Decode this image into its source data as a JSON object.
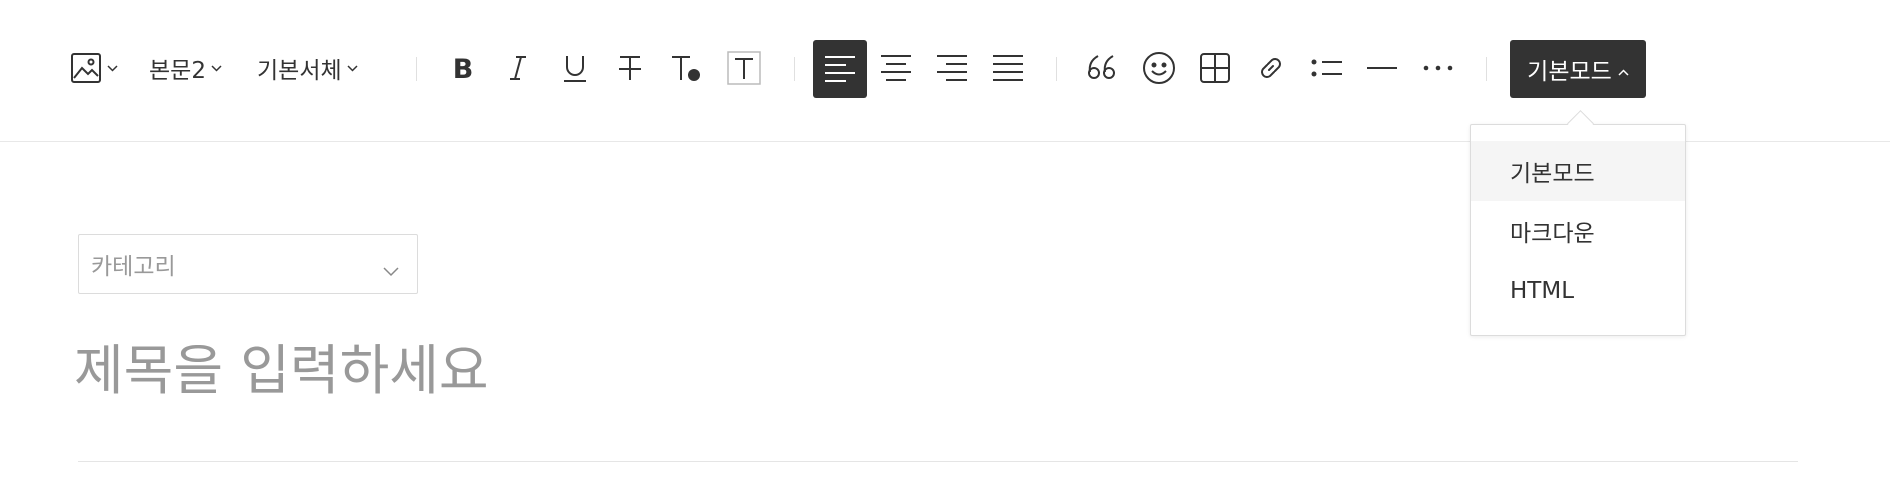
{
  "toolbar": {
    "paragraph_style": "본문2",
    "font_family": "기본서체",
    "icons": [
      "image-icon",
      "bold-icon",
      "italic-icon",
      "underline-icon",
      "strikethrough-icon",
      "text-color-icon",
      "text-background-icon",
      "align-left-icon",
      "align-center-icon",
      "align-right-icon",
      "align-justify-icon",
      "quote-icon",
      "emoji-icon",
      "table-icon",
      "link-icon",
      "list-icon",
      "horizontal-rule-icon",
      "more-icon"
    ],
    "active_alignment": "left",
    "mode_label": "기본모드"
  },
  "mode_dropdown": {
    "items": [
      "기본모드",
      "마크다운",
      "HTML"
    ],
    "selected": "기본모드"
  },
  "editor": {
    "category_placeholder": "카테고리",
    "title_placeholder": "제목을 입력하세요"
  },
  "colors": {
    "accent_dark": "#333333",
    "placeholder": "#999999",
    "border": "#dcdcdc"
  }
}
